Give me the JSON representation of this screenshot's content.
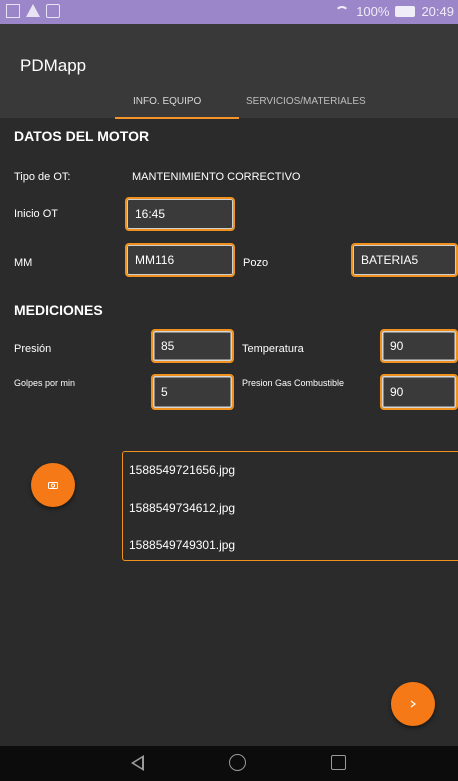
{
  "status_bar": {
    "battery_text": "100%",
    "time": "20:49"
  },
  "app": {
    "title": "PDMapp"
  },
  "tabs": [
    {
      "label": "INFO. EQUIPO"
    },
    {
      "label": "SERVICIOS/MATERIALES"
    }
  ],
  "motor": {
    "title": "DATOS DEL MOTOR",
    "tipo_ot_label": "Tipo de OT:",
    "tipo_ot_value": "MANTENIMIENTO CORRECTIVO",
    "inicio_ot_label": "Inicio OT",
    "inicio_ot_value": "16:45",
    "mm_label": "MM",
    "mm_value": "MM116",
    "pozo_label": "Pozo",
    "pozo_value": "BATERIA5"
  },
  "mediciones": {
    "title": "MEDICIONES",
    "presion_label": "Presión",
    "presion_value": "85",
    "temperatura_label": "Temperatura",
    "temperatura_value": "90",
    "golpes_label": "Golpes por min",
    "golpes_value": "5",
    "presion_gas_label": "Presion Gas Combustible",
    "presion_gas_value": "90"
  },
  "photos": [
    {
      "name": "1588549721656.jpg"
    },
    {
      "name": "1588549734612.jpg"
    },
    {
      "name": "1588549749301.jpg"
    }
  ],
  "fab": {
    "camera_icon": "camera-icon",
    "next_icon": "arrow-right-icon"
  },
  "colors": {
    "accent": "#f5942a",
    "fab": "#f57a17",
    "statusbar": "#9b86c9",
    "appbar": "#393939",
    "background": "#2b2b2b"
  }
}
